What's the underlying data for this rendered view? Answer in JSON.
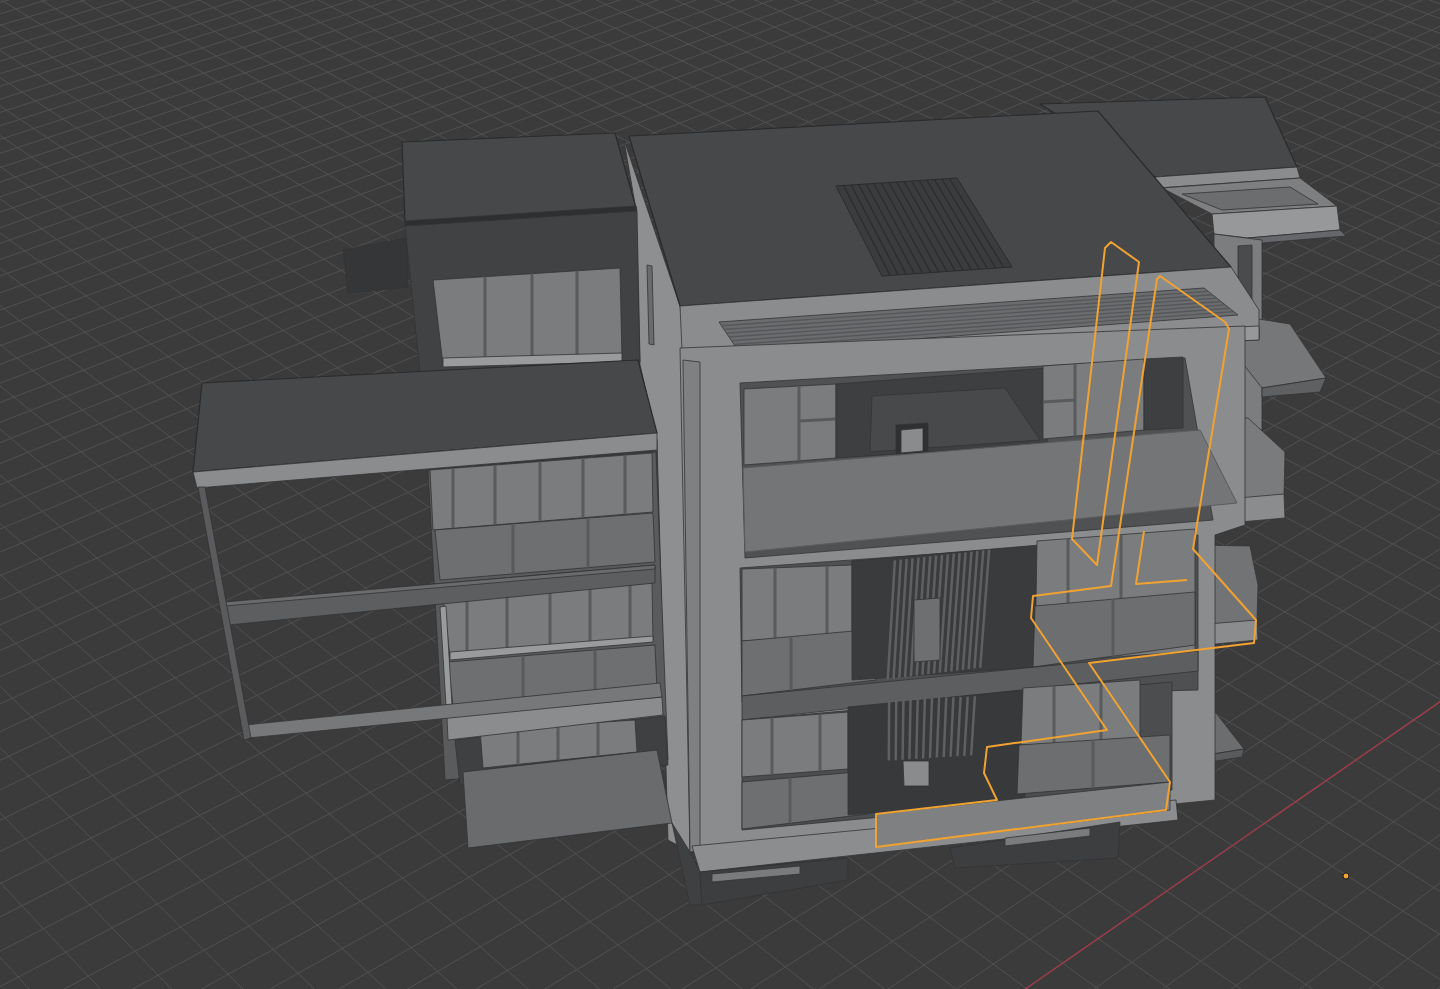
{
  "viewport": {
    "floor_grid": true,
    "x_axis": true,
    "objects": [
      {
        "kind": "building",
        "selected": false
      },
      {
        "kind": "railing",
        "selected": true
      }
    ]
  }
}
